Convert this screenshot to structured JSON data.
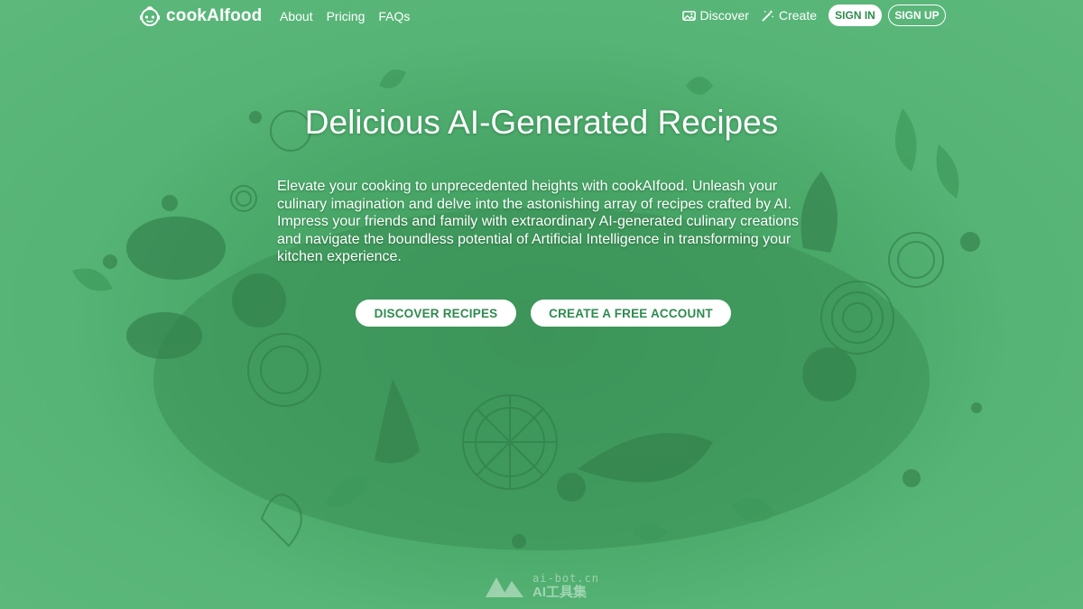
{
  "brand": {
    "name": "cookAIfood",
    "icon": "chef-robot-icon"
  },
  "nav": {
    "links": [
      "About",
      "Pricing",
      "FAQs"
    ],
    "discover_label": "Discover",
    "discover_icon": "image-icon",
    "create_label": "Create",
    "create_icon": "magic-wand-icon",
    "signin_label": "SIGN IN",
    "signup_label": "SIGN UP"
  },
  "hero": {
    "title": "Delicious AI-Generated Recipes",
    "description": "Elevate your cooking to unprecedented heights with cookAIfood. Unleash your culinary imagination and delve into the astonishing array of recipes crafted by AI. Impress your friends and family with extraordinary AI-generated culinary creations and navigate the boundless potential of Artificial Intelligence in transforming your kitchen experience.",
    "cta_discover": "DISCOVER RECIPES",
    "cta_create": "CREATE A FREE ACCOUNT"
  },
  "watermark": {
    "line1": "ai-bot.cn",
    "line2": "AI工具集"
  },
  "colors": {
    "background": "#4aa368",
    "accent": "#2e8b4f",
    "text": "#ffffff"
  }
}
